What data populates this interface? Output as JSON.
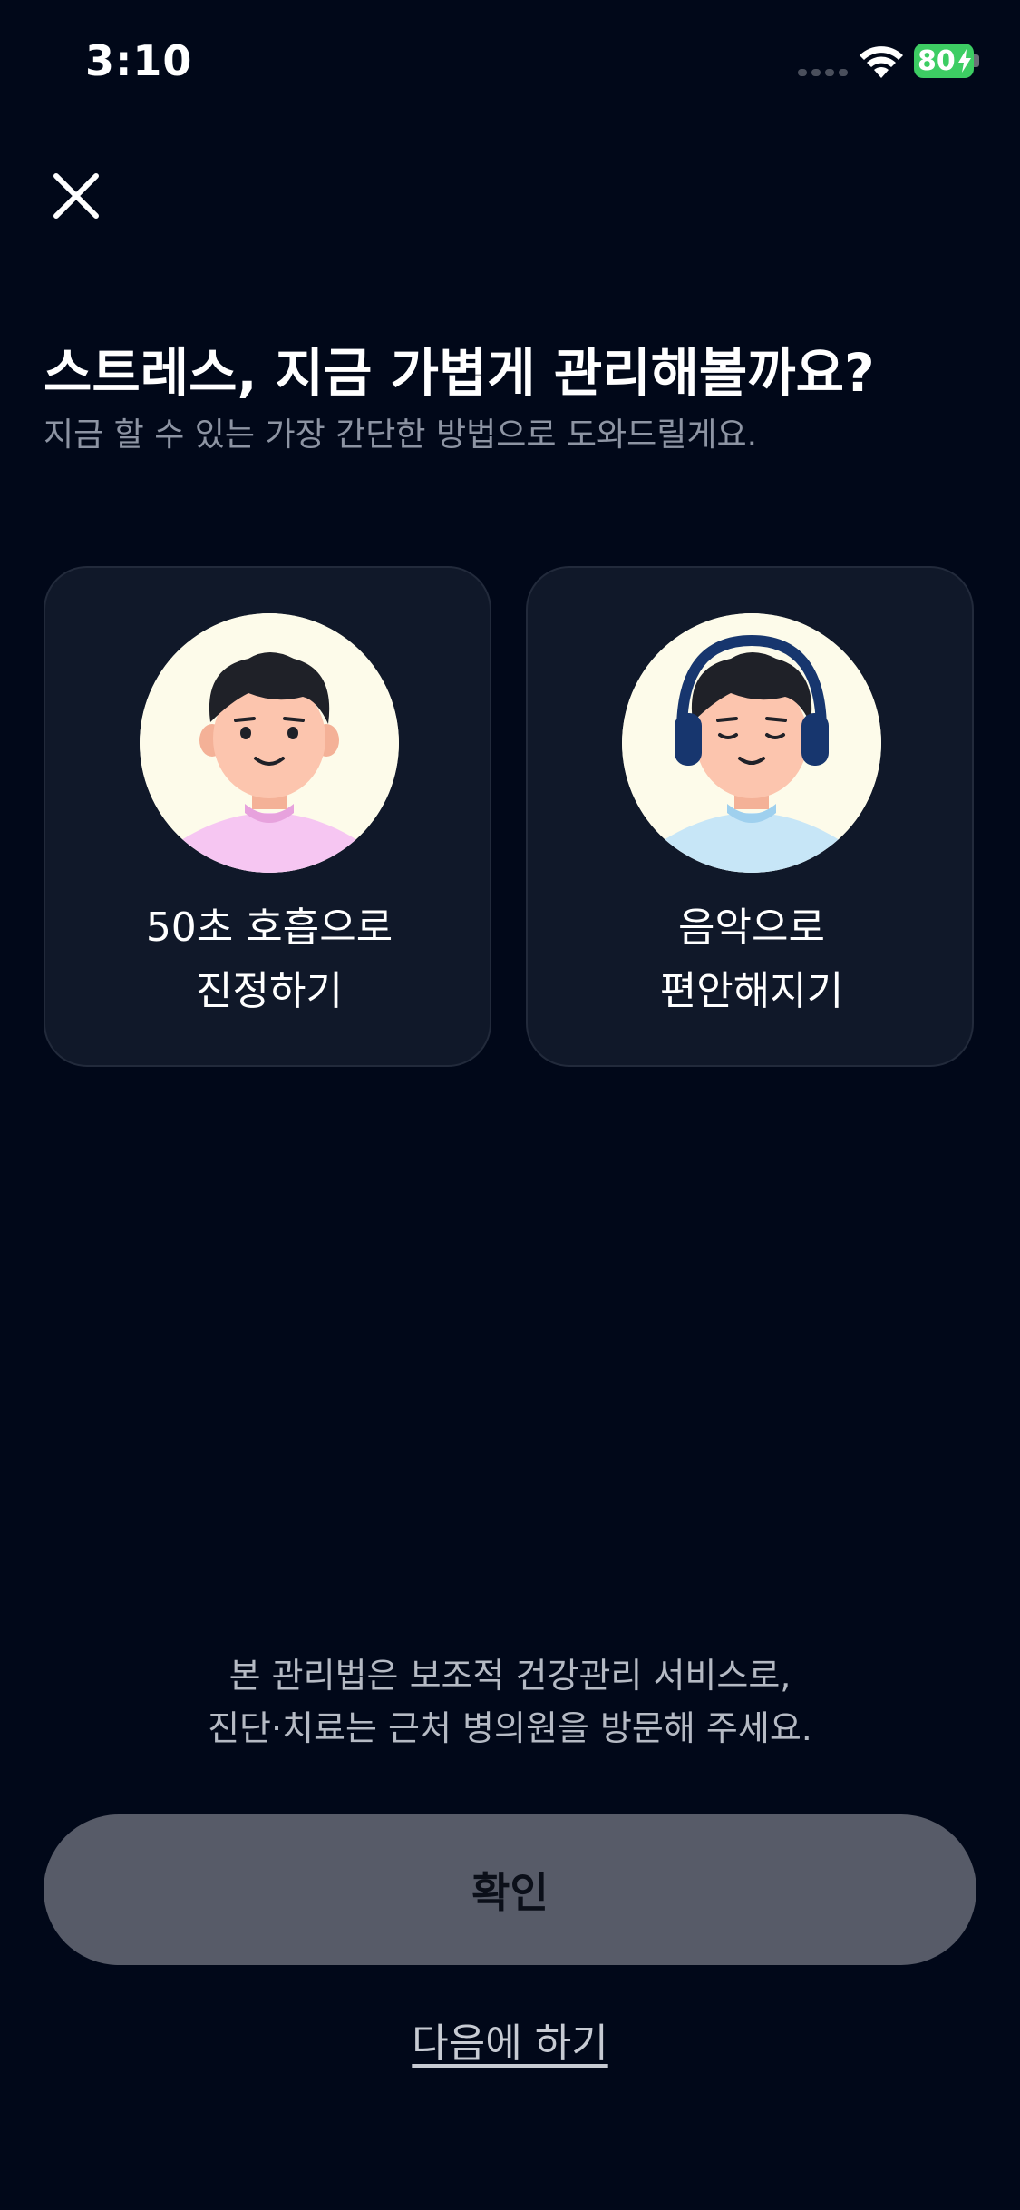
{
  "status_bar": {
    "time": "3:10",
    "battery_level": "80",
    "battery_color": "#3dcd63",
    "icons": [
      "cellular-signal-icon",
      "wifi-icon",
      "battery-icon"
    ]
  },
  "header": {
    "close_icon": "close-icon",
    "title": "스트레스, 지금 가볍게 관리해볼까요?",
    "subtitle": "지금 할 수 있는 가장 간단한 방법으로 도와드릴게요."
  },
  "options": [
    {
      "illustration": "breathing-boy-illustration",
      "shirt_color": "#f6c6f2",
      "label_line1": "50초 호흡으로",
      "label_line2": "진정하기"
    },
    {
      "illustration": "headphones-boy-illustration",
      "shirt_color": "#c7e6f7",
      "label_line1": "음악으로",
      "label_line2": "편안해지기"
    }
  ],
  "footer": {
    "disclaimer_line1": "본 관리법은 보조적 건강관리 서비스로,",
    "disclaimer_line2": "진단·치료는 근처 병의원을 방문해 주세요.",
    "confirm_label": "확인",
    "later_label": "다음에 하기"
  },
  "colors": {
    "background": "#010819",
    "card_background": "#101829",
    "button_disabled": "#575b68",
    "headphones": "#17366e"
  }
}
